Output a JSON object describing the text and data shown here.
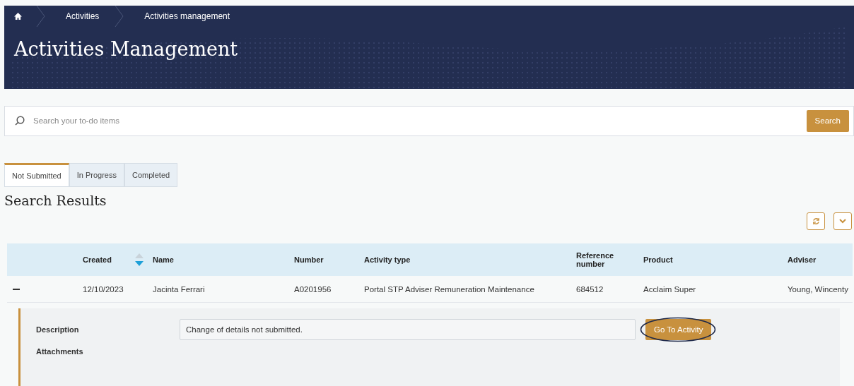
{
  "breadcrumbs": [
    "Activities",
    "Activities management"
  ],
  "title": "Activities Management",
  "search": {
    "placeholder": "Search your to-do items",
    "button": "Search"
  },
  "tabs": [
    {
      "label": "Not Submitted",
      "selected": true
    },
    {
      "label": "In Progress",
      "selected": false
    },
    {
      "label": "Completed",
      "selected": false
    }
  ],
  "results_title": "Search Results",
  "table": {
    "columns": [
      {
        "label": "Created",
        "sorted_descending": true
      },
      {
        "label": "Name"
      },
      {
        "label": "Number"
      },
      {
        "label": "Activity type"
      },
      {
        "label": "Reference number"
      },
      {
        "label": "Product"
      },
      {
        "label": "Adviser"
      }
    ],
    "rows": [
      {
        "expanded": true,
        "cells": [
          "12/10/2023",
          "Jacinta Ferrari",
          "A0201956",
          "Portal STP Adviser Remuneration Maintenance",
          "684512",
          "Acclaim Super",
          "Young, Wincenty"
        ],
        "details": {
          "description_label": "Description",
          "description": "Change of details not submitted.",
          "button": "Go To Activity",
          "button_highlighted": true,
          "attachments_label": "Attachments"
        }
      }
    ]
  }
}
